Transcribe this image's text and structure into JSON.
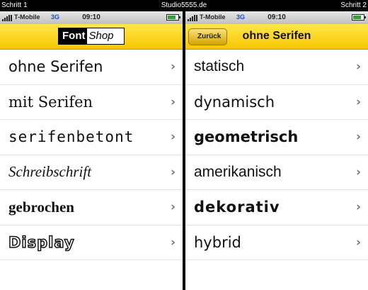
{
  "caption": {
    "left": "Schritt 1",
    "center": "Studio5555.de",
    "right": "Schritt 2"
  },
  "status_bar": {
    "carrier": "T-Mobile",
    "network": "3G",
    "time": "09:10"
  },
  "screen1": {
    "logo": {
      "part1": "Font",
      "part2": "Shop"
    },
    "items": [
      {
        "label": "ohne Serifen"
      },
      {
        "label": "mit Serifen"
      },
      {
        "label": "serifenbetont"
      },
      {
        "label": "Schreibschrift"
      },
      {
        "label": "gebrochen"
      },
      {
        "label": "Display"
      }
    ]
  },
  "screen2": {
    "back_label": "Zurück",
    "title": "ohne Serifen",
    "items": [
      {
        "label": "statisch"
      },
      {
        "label": "dynamisch"
      },
      {
        "label": "geometrisch"
      },
      {
        "label": "amerikanisch"
      },
      {
        "label": "dekorativ"
      },
      {
        "label": "hybrid"
      }
    ]
  },
  "icons": {
    "chevron": "chevron-right-icon",
    "signal": "signal-icon",
    "battery": "battery-icon"
  },
  "colors": {
    "nav_yellow": "#f7c600",
    "network_blue": "#1a4fb8",
    "battery_green": "#2fa12f"
  }
}
